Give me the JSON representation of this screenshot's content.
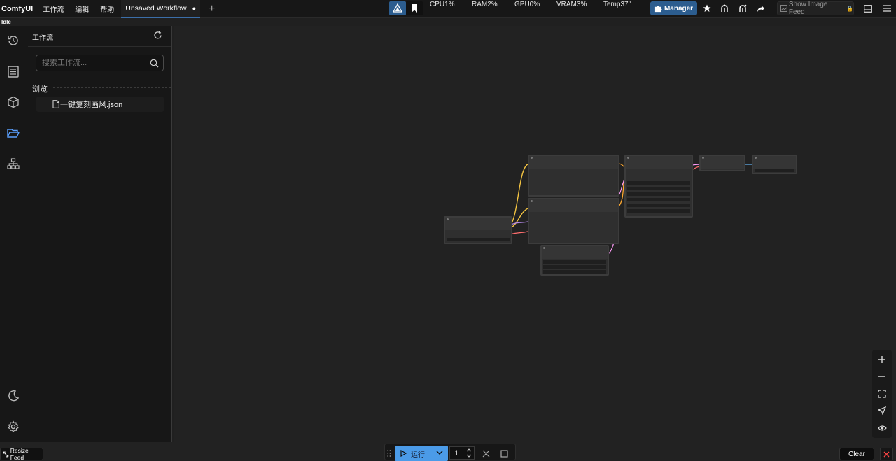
{
  "app": {
    "brand": "ComfyUI"
  },
  "menu": {
    "items": [
      "工作流",
      "编辑",
      "帮助"
    ]
  },
  "tabs": [
    {
      "label": "Unsaved Workflow",
      "modified_marker": "●"
    }
  ],
  "stats": {
    "cpu": "CPU1%",
    "ram": "RAM2%",
    "gpu": "GPU0%",
    "vram": "VRAM3%",
    "temp": "Temp37°"
  },
  "toolbar": {
    "manager_label": "Manager",
    "feed_label": "Show Image Feed",
    "feed_icon": "🔒"
  },
  "status": {
    "text": "Idle"
  },
  "sidebar": {
    "title": "工作流",
    "search_placeholder": "搜索工作流...",
    "section": "浏览",
    "files": [
      "一键复刻画风.json"
    ]
  },
  "bottom": {
    "resize_label": "Resize Feed",
    "run_label": "运行",
    "batch_count": "1",
    "clear_label": "Clear"
  },
  "colors": {
    "accent": "#2c5d8f",
    "run": "#4b9be8",
    "clip_wire": "#f5c542",
    "model_wire": "#b388e8",
    "vae_wire": "#ff6e6e",
    "cond_wire": "#ffa931",
    "latent_wire": "#ff9cf9",
    "image_wire": "#64b5f6"
  }
}
